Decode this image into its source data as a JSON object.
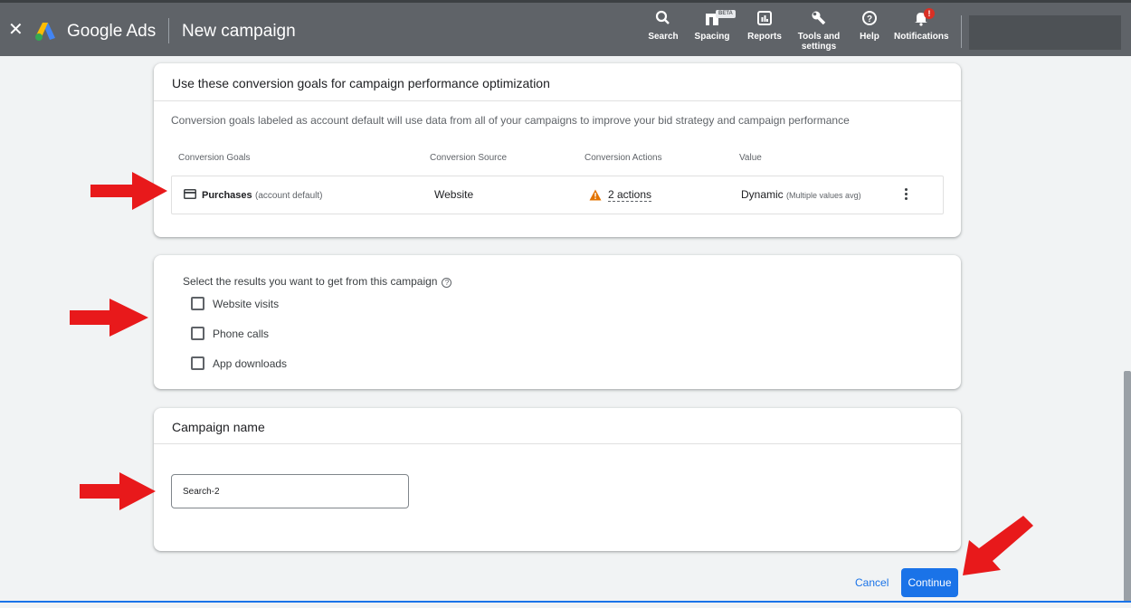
{
  "app": {
    "brand": "Google Ads",
    "page_title": "New campaign",
    "close_icon": "close-icon",
    "logo_icon": "google-ads-logo"
  },
  "toolbar": {
    "search": "Search",
    "spacing": "Spacing",
    "spacing_badge": "BETA",
    "reports": "Reports",
    "tools": "Tools and settings",
    "help": "Help",
    "notifications": "Notifications",
    "notifications_badge": "!"
  },
  "goals_card": {
    "title": "Use these conversion goals for campaign performance optimization",
    "description": "Conversion goals labeled as account default will use data from all of your campaigns to improve your bid strategy and campaign performance",
    "columns": [
      "Conversion Goals",
      "Conversion Source",
      "Conversion Actions",
      "Value"
    ],
    "row": {
      "goal": "Purchases",
      "goal_note": "(account default)",
      "source": "Website",
      "actions": "2 actions",
      "value": "Dynamic",
      "value_note": "(Multiple values avg)"
    }
  },
  "results_card": {
    "label": "Select the results you want to get from this campaign",
    "options": [
      {
        "label": "Website visits",
        "checked": false
      },
      {
        "label": "Phone calls",
        "checked": false
      },
      {
        "label": "App downloads",
        "checked": false
      }
    ]
  },
  "name_card": {
    "title": "Campaign name",
    "value": "Search-2"
  },
  "footer": {
    "cancel": "Cancel",
    "continue": "Continue"
  },
  "colors": {
    "topbar": "#5f6368",
    "primary": "#1a73e8",
    "warning": "#e37400",
    "annotation_arrow": "#e8191b"
  }
}
